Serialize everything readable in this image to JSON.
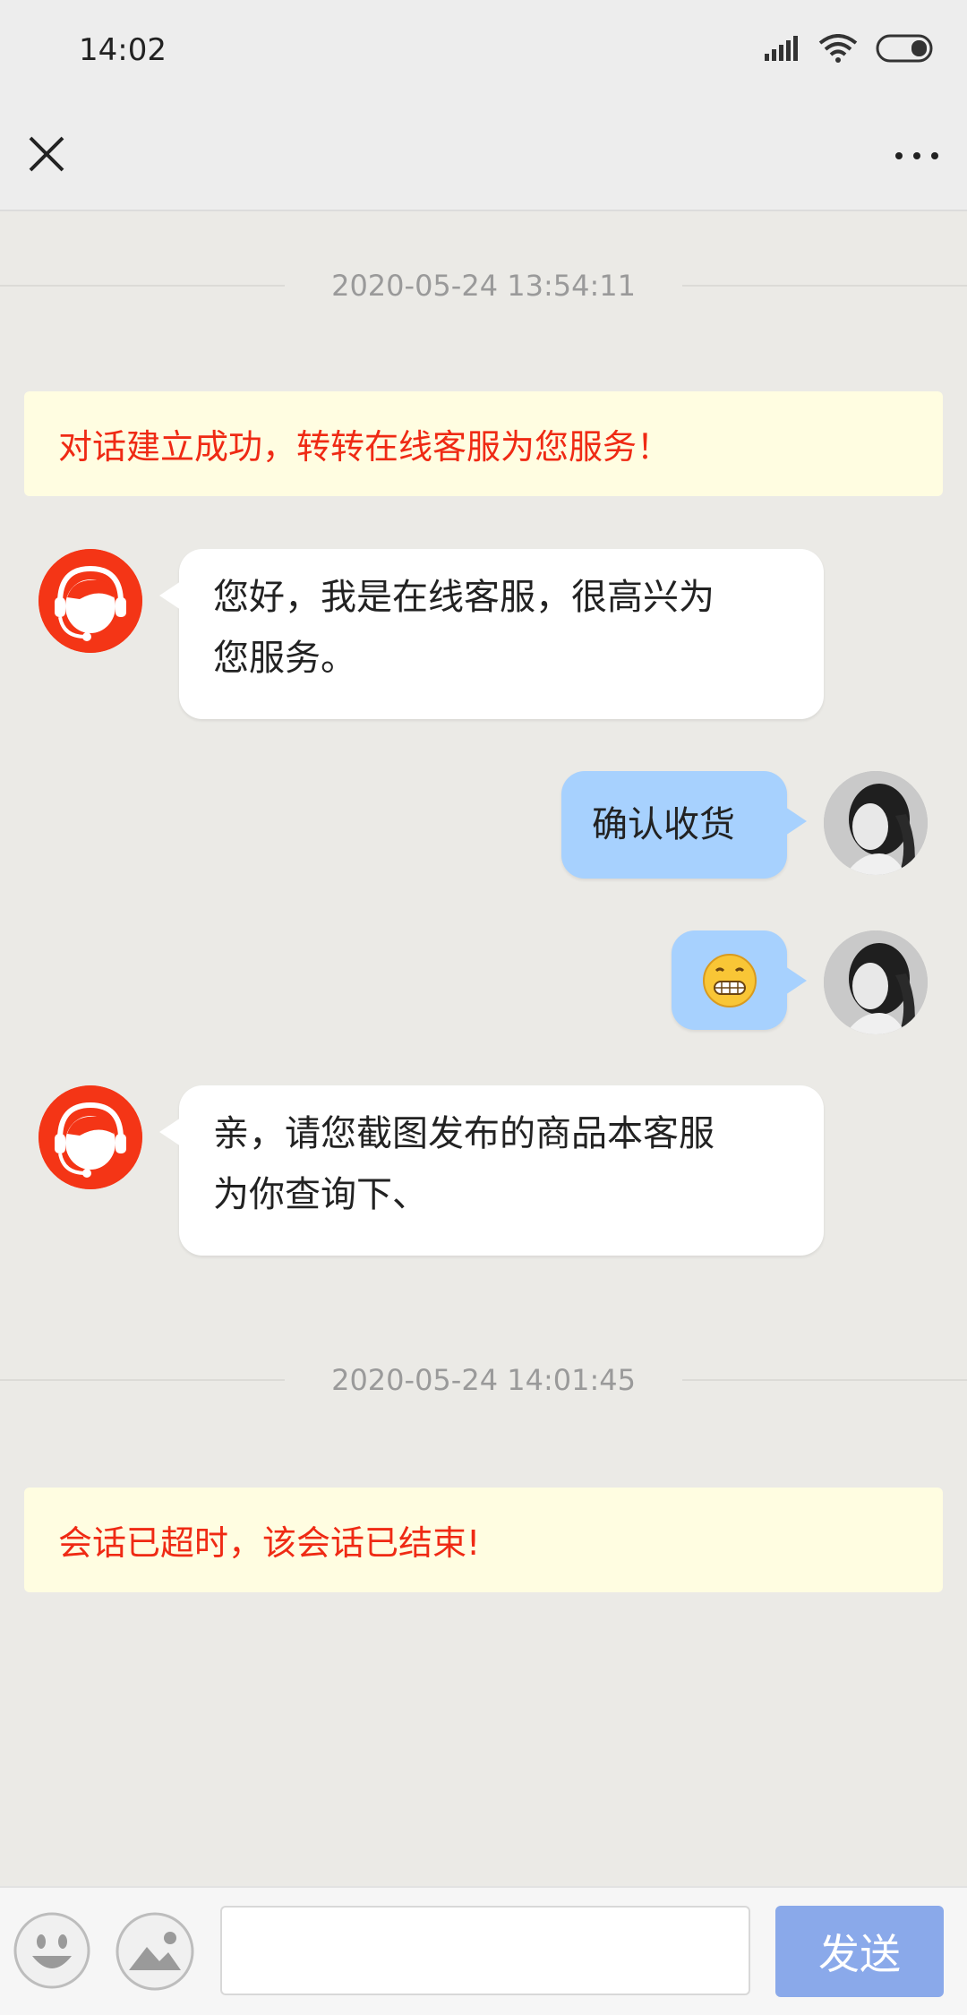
{
  "status_bar": {
    "time": "14:02"
  },
  "nav": {
    "close_icon": "close-icon",
    "more_icon": "more-dots-icon"
  },
  "colors": {
    "notice_text": "#ef2a14",
    "notice_bg": "#fffde1",
    "agent_avatar_bg": "#f43516",
    "user_bubble": "#a7d1fe",
    "send_button": "#8aa9ea"
  },
  "chat": {
    "timestamp_1": "2020-05-24 13:54:11",
    "notice_1": "对话建立成功，转转在线客服为您服务！",
    "agent_msg_1_line1": "您好，我是在线客服，很高兴为",
    "agent_msg_1_line2": "您服务。",
    "user_msg_1": "确认收货",
    "user_msg_2_emoji": "grinning-face-emoji",
    "agent_msg_2_line1": "亲，请您截图发布的商品本客服",
    "agent_msg_2_line2": "为你查询下、",
    "timestamp_2": "2020-05-24 14:01:45",
    "notice_2": "会话已超时，该会话已结束!"
  },
  "input_bar": {
    "emoji_icon": "emoji-icon",
    "image_icon": "image-icon",
    "input_value": "",
    "send_label": "发送"
  }
}
